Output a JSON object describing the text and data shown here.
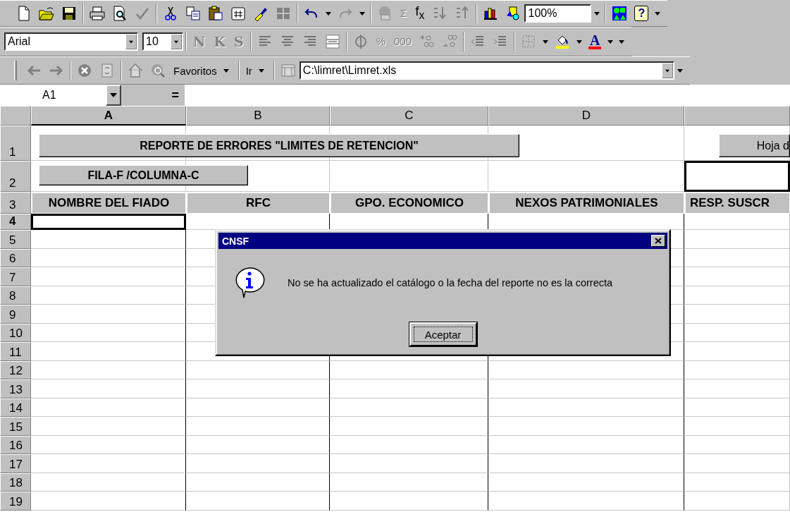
{
  "standard_toolbar": {
    "autosum": "Σ",
    "function": "f$_{x}$",
    "zoom": "100%",
    "help": "?"
  },
  "formatting_toolbar": {
    "font": "Arial",
    "size": "10",
    "style_buttons": [
      {
        "label": "N",
        "disabled": true
      },
      {
        "label": "K",
        "disabled": true
      },
      {
        "label": "S",
        "disabled": true
      }
    ],
    "number_buttons": [
      {
        "label": "%",
        "disabled": true
      },
      {
        "label": "000",
        "disabled": true
      }
    ],
    "font_color": "A"
  },
  "web_toolbar": {
    "favorites": "Favoritos",
    "go": "Ir",
    "address": "C:\\limret\\Limret.xls"
  },
  "formula_bar": {
    "name_box": "A1",
    "equals": "="
  },
  "sheet": {
    "columns": [
      {
        "label": "A",
        "selected": true
      },
      {
        "label": "B",
        "selected": false
      },
      {
        "label": "C",
        "selected": false
      },
      {
        "label": "D",
        "selected": false
      },
      {
        "selected": false
      }
    ],
    "rows": [
      {
        "label": "1",
        "selected": false
      },
      {
        "label": "2",
        "selected": false
      },
      {
        "label": "3",
        "selected": false
      },
      {
        "label": "4",
        "selected": true
      },
      {
        "label": "5",
        "selected": false
      },
      {
        "label": "6",
        "selected": false
      },
      {
        "label": "7",
        "selected": false
      },
      {
        "label": "8",
        "selected": false
      },
      {
        "label": "9",
        "selected": false
      },
      {
        "label": "10",
        "selected": false
      },
      {
        "label": "11",
        "selected": false
      },
      {
        "label": "12",
        "selected": false
      },
      {
        "label": "13",
        "selected": false
      },
      {
        "label": "14",
        "selected": false
      },
      {
        "label": "15",
        "selected": false
      },
      {
        "label": "16",
        "selected": false
      },
      {
        "label": "17",
        "selected": false
      },
      {
        "label": "18",
        "selected": false
      },
      {
        "label": "19",
        "selected": false
      }
    ],
    "header_row": [
      "NOMBRE DEL FIADO",
      "RFC",
      "GPO. ECONOMICO",
      "NEXOS PATRIMONIALES",
      "RESP. SUSCR"
    ],
    "buttons": [
      {
        "label": "REPORTE DE ERRORES \"LIMITES DE RETENCION\""
      },
      {
        "label": "FILA-F /COLUMNA-C"
      },
      {
        "label": "Hoja d"
      }
    ]
  },
  "dialog": {
    "title": "CNSF",
    "message": "No se ha actualizado el catálogo o la fecha del reporte no es la correcta",
    "button": "Aceptar"
  }
}
